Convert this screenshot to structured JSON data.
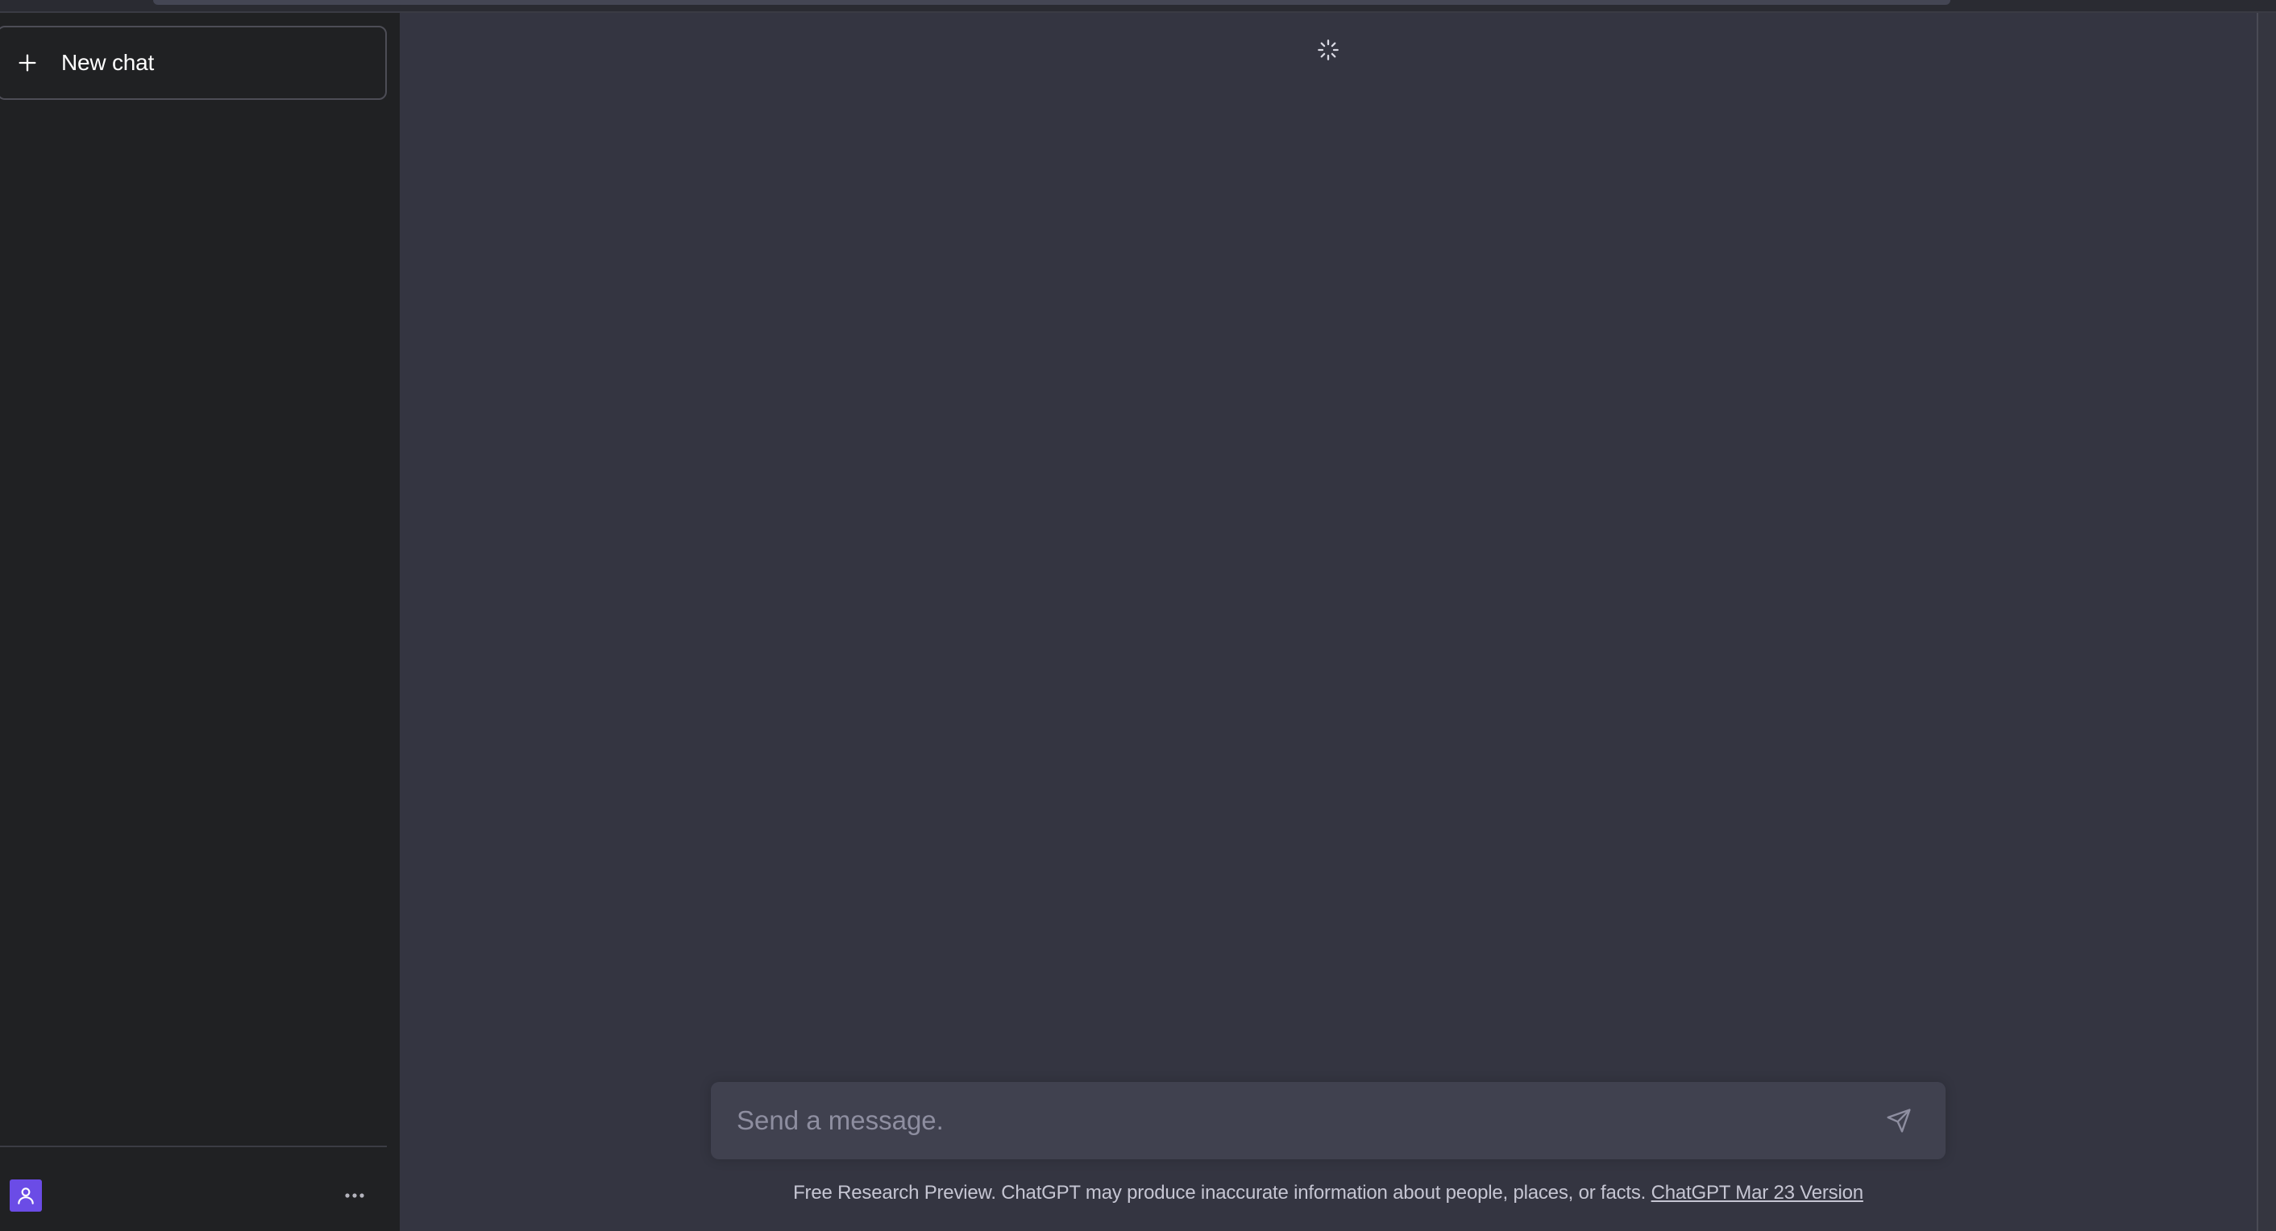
{
  "sidebar": {
    "new_chat_label": "New chat"
  },
  "composer": {
    "placeholder": "Send a message."
  },
  "footer": {
    "disclaimer": "Free Research Preview. ChatGPT may produce inaccurate information about people, places, or facts. ",
    "version_link": "ChatGPT Mar 23 Version"
  },
  "colors": {
    "sidebar_bg": "#202123",
    "main_bg": "#343541",
    "composer_bg": "#40414f",
    "avatar_bg": "#6b4ce6"
  },
  "icons": {
    "new_chat": "plus-icon",
    "loading": "spinner-icon",
    "send": "paper-plane-icon",
    "user": "user-icon",
    "menu": "more-horizontal-icon"
  }
}
